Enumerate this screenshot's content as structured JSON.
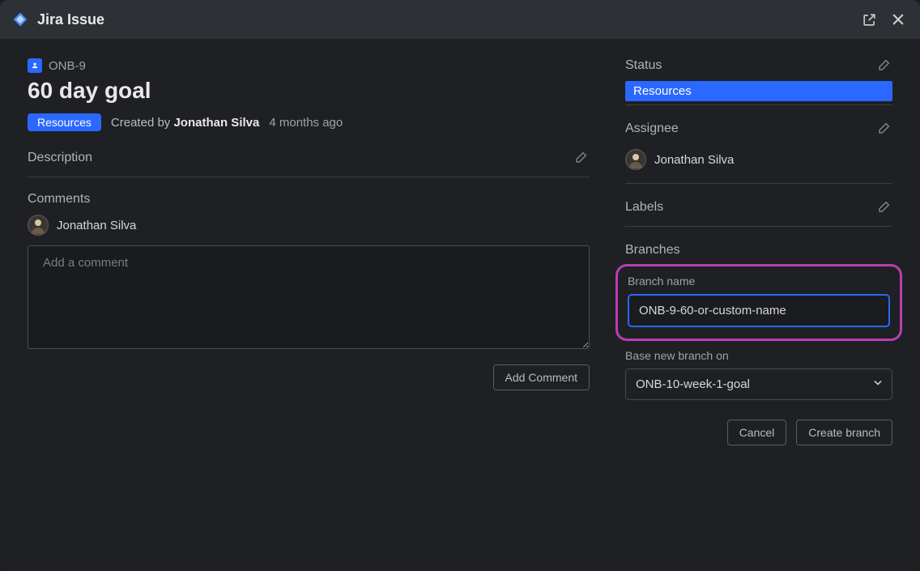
{
  "titlebar": {
    "app_name": "Jira Issue"
  },
  "issue": {
    "key": "ONB-9",
    "title": "60 day goal",
    "status_badge": "Resources",
    "created_by_label": "Created by",
    "author": "Jonathan Silva",
    "created_ago": "4 months ago"
  },
  "left": {
    "description_label": "Description",
    "comments_label": "Comments",
    "comment_author": "Jonathan Silva",
    "comment_placeholder": "Add a comment",
    "add_comment_btn": "Add Comment"
  },
  "right": {
    "status_label": "Status",
    "status_value": "Resources",
    "assignee_label": "Assignee",
    "assignee_value": "Jonathan Silva",
    "labels_label": "Labels",
    "branches_label": "Branches",
    "branch_name_label": "Branch name",
    "branch_name_value": "ONB-9-60-or-custom-name",
    "base_branch_label": "Base new branch on",
    "base_branch_value": "ONB-10-week-1-goal",
    "cancel_btn": "Cancel",
    "create_branch_btn": "Create branch"
  }
}
